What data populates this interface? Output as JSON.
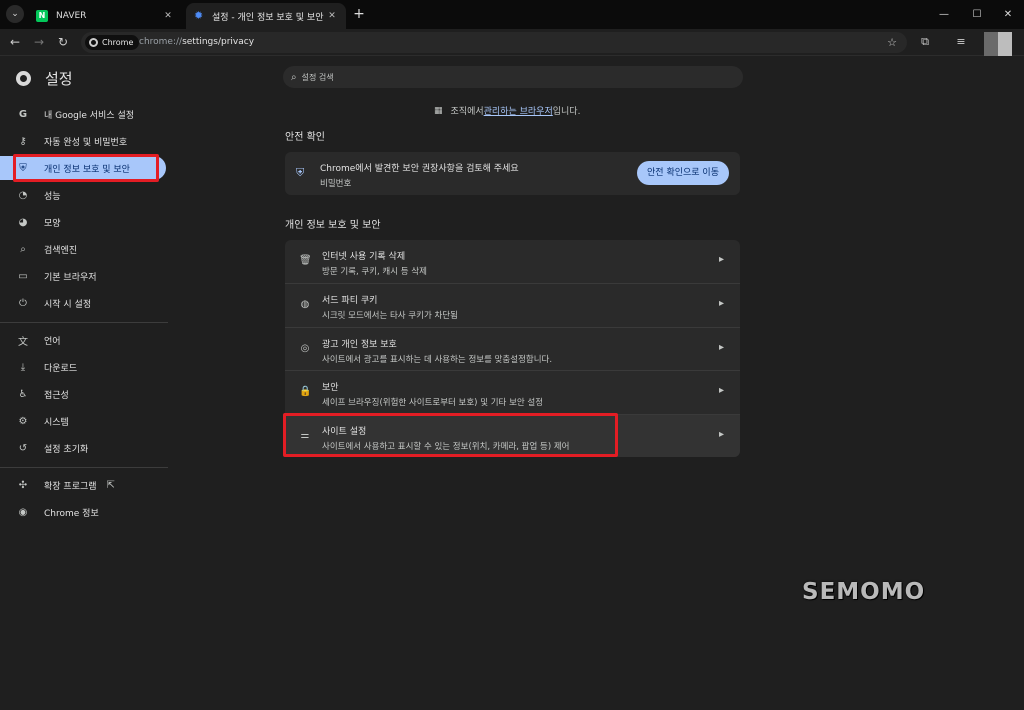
{
  "tabs": [
    {
      "title": "NAVER",
      "favicon": "N",
      "active": false
    },
    {
      "title": "설정 - 개인 정보 보호 및 보안",
      "active": true
    }
  ],
  "toolbar": {
    "site_chip": "Chrome",
    "url_prefix": "chrome://",
    "url_path": "settings/privacy"
  },
  "sidebar": {
    "title": "설정",
    "items": [
      {
        "label": "내 Google 서비스 설정",
        "icon": "google-icon"
      },
      {
        "label": "자동 완성 및 비밀번호",
        "icon": "key-icon"
      },
      {
        "label": "개인 정보 보호 및 보안",
        "icon": "shield-icon",
        "active": true
      },
      {
        "label": "성능",
        "icon": "speedometer-icon"
      },
      {
        "label": "모양",
        "icon": "palette-icon"
      },
      {
        "label": "검색엔진",
        "icon": "search-icon"
      },
      {
        "label": "기본 브라우저",
        "icon": "browser-icon"
      },
      {
        "label": "시작 시 설정",
        "icon": "power-icon"
      },
      {
        "label": "언어",
        "icon": "translate-icon"
      },
      {
        "label": "다운로드",
        "icon": "download-icon"
      },
      {
        "label": "접근성",
        "icon": "accessibility-icon"
      },
      {
        "label": "시스템",
        "icon": "wrench-icon"
      },
      {
        "label": "설정 초기화",
        "icon": "reset-icon"
      },
      {
        "label": "확장 프로그램",
        "icon": "puzzle-icon"
      },
      {
        "label": "Chrome 정보",
        "icon": "chrome-icon"
      }
    ]
  },
  "search": {
    "placeholder": "설정 검색"
  },
  "managed": {
    "before": "조직에서 ",
    "link": "관리하는 브라우저",
    "after": "입니다."
  },
  "safety": {
    "section_title": "안전 확인",
    "title": "Chrome에서 발견한 보안 권장사항을 검토해 주세요",
    "subtitle": "비밀번호",
    "button": "안전 확인으로 이동"
  },
  "privacy": {
    "section_title": "개인 정보 보호 및 보안",
    "rows": [
      {
        "title": "인터넷 사용 기록 삭제",
        "subtitle": "방문 기록, 쿠키, 캐시 등 삭제",
        "icon": "trash-icon"
      },
      {
        "title": "서드 파티 쿠키",
        "subtitle": "시크릿 모드에서는 타사 쿠키가 차단됨",
        "icon": "cookie-icon"
      },
      {
        "title": "광고 개인 정보 보호",
        "subtitle": "사이트에서 광고를 표시하는 데 사용하는 정보를 맞춤설정합니다.",
        "icon": "ad-privacy-icon"
      },
      {
        "title": "보안",
        "subtitle": "세이프 브라우징(위험한 사이트로부터 보호) 및 기타 보안 설정",
        "icon": "lock-icon"
      },
      {
        "title": "사이트 설정",
        "subtitle": "사이트에서 사용하고 표시할 수 있는 정보(위치, 카메라, 팝업 등) 제어",
        "icon": "sliders-icon"
      }
    ]
  },
  "watermark": "SEMOMO",
  "colors": {
    "accent": "#a8c7fa",
    "highlight": "#e31d24"
  }
}
